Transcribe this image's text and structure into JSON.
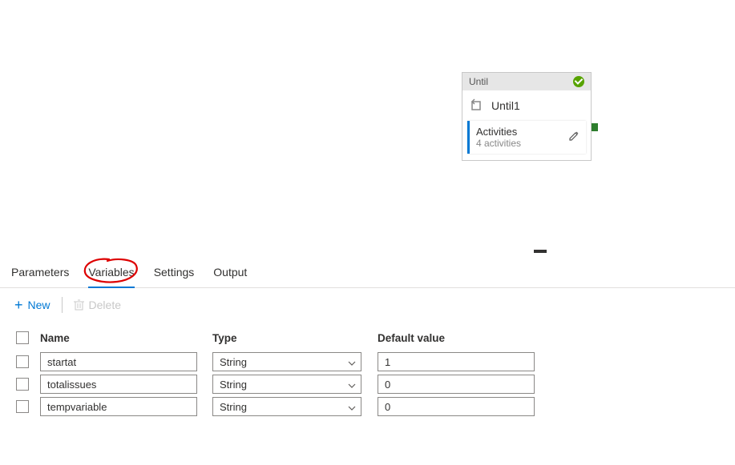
{
  "activity": {
    "type_label": "Until",
    "name": "Until1",
    "sub_label": "Activities",
    "sub_count": "4 activities"
  },
  "tabs": {
    "parameters": "Parameters",
    "variables": "Variables",
    "settings": "Settings",
    "output": "Output"
  },
  "toolbar": {
    "new_label": "New",
    "delete_label": "Delete"
  },
  "table": {
    "headers": {
      "name": "Name",
      "type": "Type",
      "default": "Default value"
    },
    "rows": [
      {
        "name": "startat",
        "type": "String",
        "default": "1"
      },
      {
        "name": "totalissues",
        "type": "String",
        "default": "0"
      },
      {
        "name": "tempvariable",
        "type": "String",
        "default": "0"
      }
    ]
  }
}
